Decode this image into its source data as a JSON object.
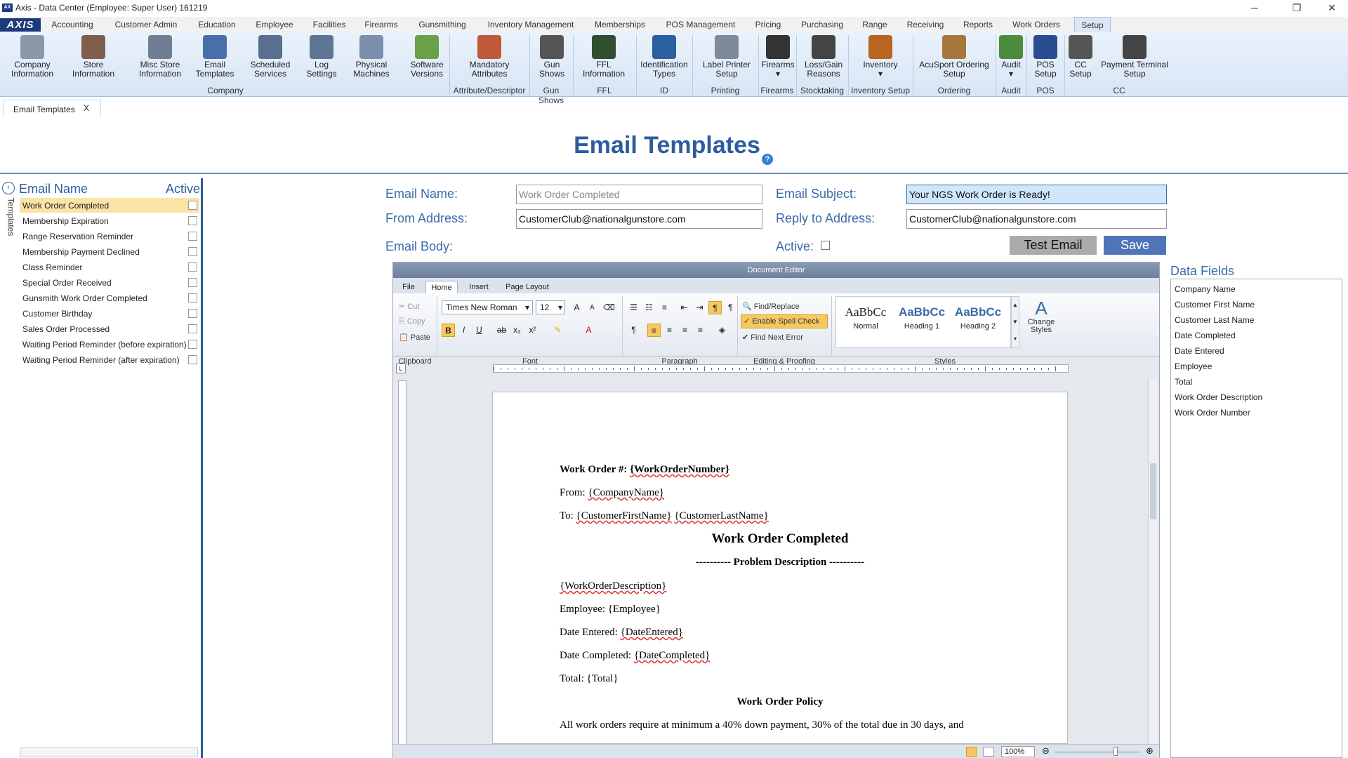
{
  "window": {
    "title": "Axis - Data Center  (Employee: Super User) 161219",
    "logo": "AXIS",
    "controls": [
      "─",
      "❐",
      "✕"
    ]
  },
  "menu": [
    "Accounting",
    "Customer Admin",
    "Education",
    "Employee",
    "Facilities",
    "Firearms",
    "Gunsmithing",
    "Inventory Management",
    "Memberships",
    "POS Management",
    "Pricing",
    "Purchasing",
    "Range",
    "Receiving",
    "Reports",
    "Work Orders",
    "Setup"
  ],
  "ribbon": {
    "buttons": [
      {
        "label": "Company\nInformation",
        "icon": "building-icon"
      },
      {
        "label": "Store\nInformation",
        "icon": "store-icon"
      },
      {
        "label": "Misc Store\nInformation",
        "icon": "store-misc-icon"
      },
      {
        "label": "Email\nTemplates",
        "icon": "email-icon"
      },
      {
        "label": "Scheduled\nServices",
        "icon": "schedule-icon"
      },
      {
        "label": "Log\nSettings",
        "icon": "log-icon"
      },
      {
        "label": "Physical\nMachines",
        "icon": "machine-icon"
      },
      {
        "label": "Software\nVersions",
        "icon": "software-icon"
      },
      {
        "label": "Mandatory\nAttributes",
        "icon": "attributes-icon"
      },
      {
        "label": "Gun\nShows",
        "icon": "gun-shows-icon"
      },
      {
        "label": "FFL\nInformation",
        "icon": "ffl-seal-icon"
      },
      {
        "label": "Identification\nTypes",
        "icon": "id-card-icon"
      },
      {
        "label": "Label Printer\nSetup",
        "icon": "printer-icon"
      },
      {
        "label": "Firearms\n▾",
        "icon": "pistol-icon"
      },
      {
        "label": "Loss/Gain\nReasons",
        "icon": "loss-gain-icon"
      },
      {
        "label": "Inventory\n▾",
        "icon": "inventory-icon"
      },
      {
        "label": "AcuSport Ordering\nSetup",
        "icon": "acusport-icon"
      },
      {
        "label": "Audit\n▾",
        "icon": "audit-icon"
      },
      {
        "label": "POS\nSetup",
        "icon": "pos-icon"
      },
      {
        "label": "CC\nSetup",
        "icon": "cc-terminal-icon"
      },
      {
        "label": "Payment Terminal\nSetup",
        "icon": "payment-terminal-icon"
      }
    ],
    "groups": [
      "Company",
      "Attribute/Descriptor",
      "Gun Shows",
      "FFL",
      "ID",
      "Printing",
      "Firearms",
      "Stocktaking",
      "Inventory Setup",
      "Ordering",
      "Audit",
      "POS",
      "CC"
    ]
  },
  "doc_tab": {
    "label": "Email Templates",
    "close": "X"
  },
  "page_title": "Email Templates",
  "help": "?",
  "left_panel": {
    "side_label": "Templates",
    "col_name": "Email Name",
    "col_active": "Active",
    "items": [
      "Work Order Completed",
      "Membership Expiration",
      "Range Reservation Reminder",
      "Membership Payment Declined",
      "Class Reminder",
      "Special Order Received",
      "Gunsmith Work Order Completed",
      "Customer Birthday",
      "Sales Order Processed",
      "Waiting Period Reminder (before expiration)",
      "Waiting Period Reminder (after expiration)"
    ]
  },
  "form": {
    "email_name_label": "Email Name:",
    "email_name": "Work Order Completed",
    "email_subject_label": "Email Subject:",
    "email_subject": "Your NGS Work Order is Ready!",
    "from_label": "From Address:",
    "from": "CustomerClub@nationalgunstore.com",
    "reply_label": "Reply to Address:",
    "reply": "CustomerClub@nationalgunstore.com",
    "body_label": "Email Body:",
    "active_label": "Active:",
    "test_btn": "Test Email",
    "save_btn": "Save"
  },
  "editor": {
    "title": "Document Editor",
    "tabs": [
      "File",
      "Home",
      "Insert",
      "Page Layout"
    ],
    "clipboard": {
      "cut": "Cut",
      "copy": "Copy",
      "paste": "Paste",
      "group": "Clipboard"
    },
    "font": {
      "name": "Times New Roman",
      "size": "12",
      "group": "Font"
    },
    "paragraph_group": "Paragraph",
    "editing": {
      "find": "Find/Replace",
      "spell": "Enable Spell Check",
      "next": "Find Next Error",
      "group": "Editing & Proofing"
    },
    "styles": {
      "sample": "AaBbCc",
      "normal": "Normal",
      "h1": "Heading 1",
      "h2": "Heading 2",
      "change": "Change\nStyles",
      "group": "Styles"
    },
    "zoom": "100%",
    "body": {
      "wo_label": "Work Order #:",
      "wo_field": "{WorkOrderNumber}",
      "from_label": "From:",
      "from_field": "{CompanyName}",
      "to_label": "To:",
      "to_first": "{CustomerFirstName}",
      "to_last": "{CustomerLastName}",
      "heading": "Work Order Completed",
      "problem": "---------- Problem Description ----------",
      "desc": "{WorkOrderDescription}",
      "emp_label": "Employee:",
      "emp_field": "{Employee}",
      "entered_label": "Date Entered:",
      "entered_field": "{DateEntered}",
      "completed_label": "Date Completed:",
      "completed_field": "{DateCompleted}",
      "total_label": "Total:",
      "total_field": "{Total}",
      "policy_heading": "Work Order Policy",
      "policy_text": "All work orders require at minimum a 40% down payment, 30% of the total due in 30 days, and"
    }
  },
  "data_fields": {
    "title": "Data Fields",
    "items": [
      "Company Name",
      "Customer First Name",
      "Customer Last Name",
      "Date Completed",
      "Date Entered",
      "Employee",
      "Total",
      "Work Order Description",
      "Work Order Number"
    ]
  },
  "colors": {
    "accent": "#2d5c9e",
    "selected_row": "#fbe2a6",
    "save_button": "#4f75b8"
  }
}
